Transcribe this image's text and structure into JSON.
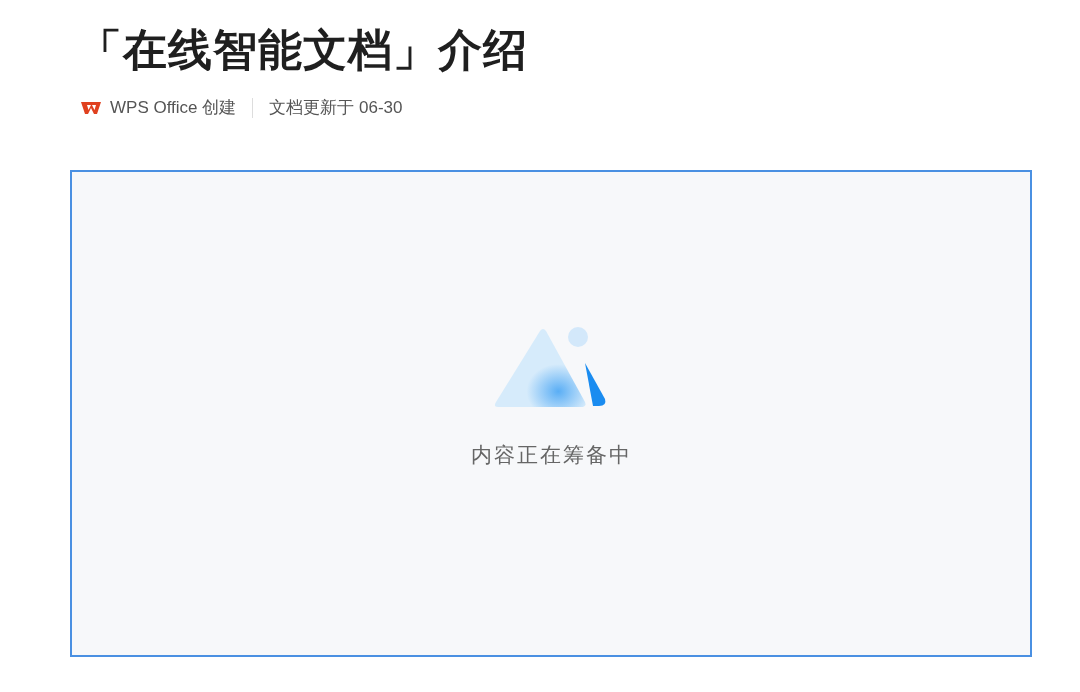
{
  "title": "「在线智能文档」介绍",
  "meta": {
    "creator": "WPS Office 创建",
    "updated": "文档更新于 06-30"
  },
  "placeholder": {
    "message": "内容正在筹备中"
  }
}
